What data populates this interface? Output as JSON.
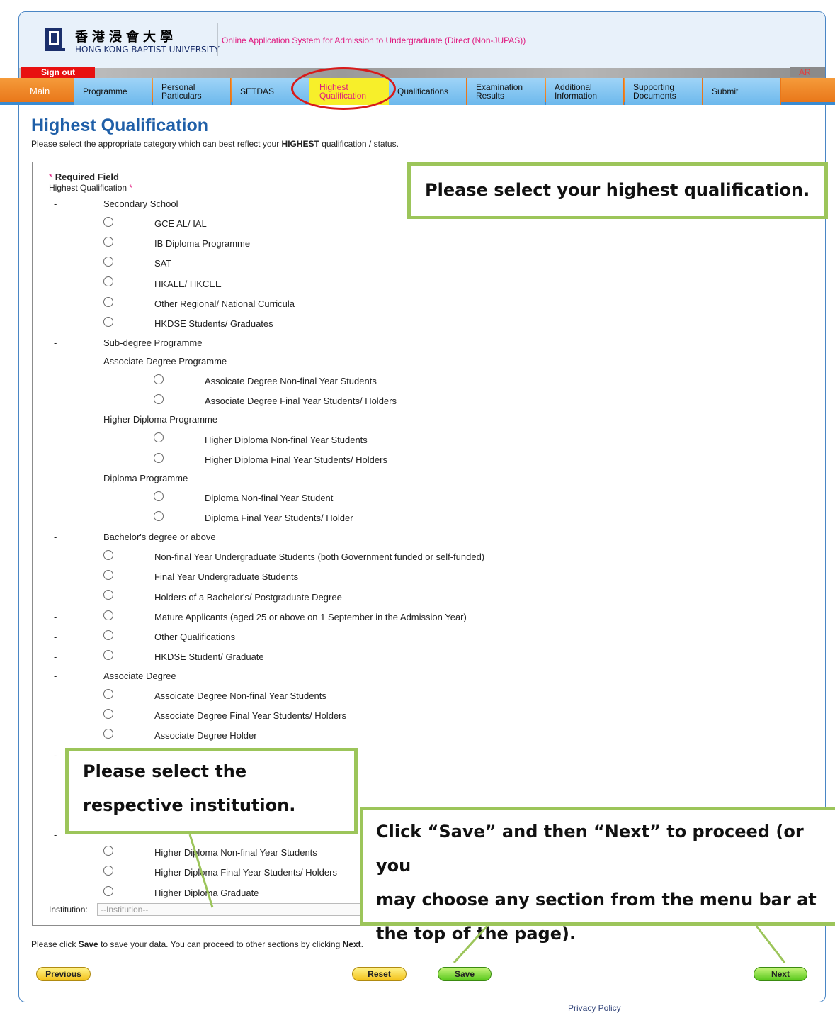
{
  "header": {
    "logo_zh": "香港浸會大學",
    "logo_en": "HONG KONG BAPTIST UNIVERSITY",
    "system_title": "Online Application System for Admission to Undergraduate (Direct (Non-JUPAS))",
    "sign_out": "Sign out",
    "lang": "AR"
  },
  "nav": {
    "main": "Main",
    "programme": "Programme",
    "personal_1": "Personal",
    "personal_2": "Particulars",
    "setdas": "SETDAS",
    "highest_1": "Highest",
    "highest_2": "Qualification",
    "qualifications": "Qualifications",
    "exam_1": "Examination",
    "exam_2": "Results",
    "additional_1": "Additional",
    "additional_2": "Information",
    "supporting_1": "Supporting",
    "supporting_2": "Documents",
    "submit": "Submit"
  },
  "page": {
    "title": "Highest Qualification",
    "subtitle_pre": "Please select the appropriate category which can best reflect your ",
    "subtitle_bold": "HIGHEST",
    "subtitle_post": " qualification / status."
  },
  "form": {
    "required_field": "Required Field",
    "star": "*",
    "highest_label": "Highest Qualification",
    "dash": "-",
    "secondary_school": "Secondary School",
    "gce": "GCE AL/ IAL",
    "ib": "IB Diploma Programme",
    "sat": "SAT",
    "hkale": "HKALE/ HKCEE",
    "other_regional": "Other Regional/ National Curricula",
    "hkdse_students": "HKDSE Students/ Graduates",
    "sub_degree": "Sub-degree Programme",
    "assoc_programme": "Associate Degree Programme",
    "assoc_nonfinal": "Assoicate Degree Non-final Year Students",
    "assoc_final": "Associate Degree Final Year Students/ Holders",
    "hd_programme": "Higher Diploma Programme",
    "hd_nonfinal": "Higher Diploma Non-final Year Students",
    "hd_final": "Higher Diploma Final Year Students/ Holders",
    "diploma_programme": "Diploma Programme",
    "diploma_nonfinal": "Diploma Non-final Year Student",
    "diploma_final": "Diploma Final Year Students/ Holder",
    "bachelor": "Bachelor's degree or above",
    "ug_nonfinal": "Non-final Year Undergraduate Students (both Government funded or self-funded)",
    "ug_final": "Final Year Undergraduate Students",
    "bachelor_holders": "Holders of a Bachelor's/ Postgraduate Degree",
    "mature": "Mature Applicants (aged 25 or above on 1 September in the Admission Year)",
    "other_qual": "Other Qualifications",
    "hkdse_student": "HKDSE Student/ Graduate",
    "assoc_degree": "Associate Degree",
    "assoc2_nonfinal": "Assoicate Degree Non-final Year Students",
    "assoc2_final": "Associate Degree Final Year Students/ Holders",
    "assoc2_holder": "Associate Degree Holder",
    "hd2_nonfinal": "Higher Diploma Non-final Year Students",
    "hd2_final": "Higher Diploma Final Year Students/ Holders",
    "hd2_graduate": "Higher Diploma Graduate",
    "institution_label": "Institution:",
    "institution_placeholder": "--Institution--"
  },
  "footer": {
    "note_pre": "Please click ",
    "note_save": "Save",
    "note_mid": " to save your data. You can proceed to other sections by clicking ",
    "note_next": "Next",
    "note_post": ".",
    "previous": "Previous",
    "reset": "Reset",
    "save": "Save",
    "next": "Next",
    "privacy": "Privacy Policy"
  },
  "callouts": {
    "c1": "Please select your highest qualification.",
    "c2_line1": "Please select the",
    "c2_line2": "respective institution.",
    "c3_line1": "Click “Save” and then “Next” to proceed (or you",
    "c3_line2": "may choose any section from the menu bar at",
    "c3_line3": "the top of the page)."
  },
  "colors": {
    "accent_blue": "#1f5fa8",
    "nav_orange": "#e9771a",
    "active_tab_yellow": "#f7ef2a",
    "magenta": "#e0197f",
    "callout_green": "#9cc55a",
    "highlight_red": "#d81a1a"
  }
}
